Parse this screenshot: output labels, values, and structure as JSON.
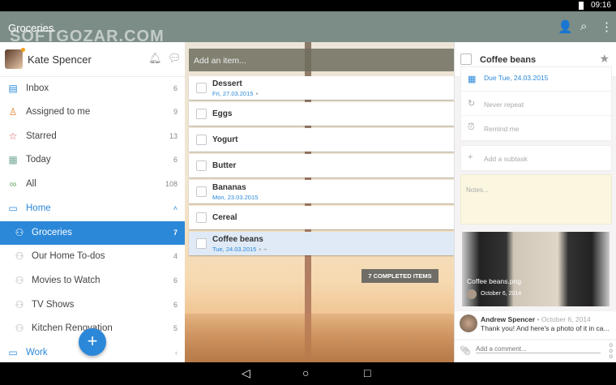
{
  "status": {
    "time": "09:16"
  },
  "appbar": {
    "title": "Groceries",
    "watermark": "SOFTGOZAR.COM"
  },
  "user": {
    "name": "Kate Spencer"
  },
  "sidebar": {
    "items": [
      {
        "label": "Inbox",
        "count": "6",
        "icon": "inbox-icon"
      },
      {
        "label": "Assigned to me",
        "count": "9",
        "icon": "person-icon"
      },
      {
        "label": "Starred",
        "count": "13",
        "icon": "star-icon"
      },
      {
        "label": "Today",
        "count": "6",
        "icon": "calendar-icon"
      },
      {
        "label": "All",
        "count": "108",
        "icon": "infinity-icon"
      },
      {
        "label": "Home",
        "count": "",
        "icon": "folder-icon"
      },
      {
        "label": "Groceries",
        "count": "7",
        "icon": "people-icon"
      },
      {
        "label": "Our Home To-dos",
        "count": "4",
        "icon": "people-icon"
      },
      {
        "label": "Movies to Watch",
        "count": "6",
        "icon": "people-icon"
      },
      {
        "label": "TV Shows",
        "count": "6",
        "icon": "people-icon"
      },
      {
        "label": "Kitchen Renovation",
        "count": "5",
        "icon": "people-icon"
      },
      {
        "label": "Work",
        "count": "",
        "icon": "folder-icon"
      }
    ]
  },
  "list": {
    "add_placeholder": "Add an item...",
    "tasks": [
      {
        "title": "Dessert",
        "date": "Fri, 27.03.2015"
      },
      {
        "title": "Eggs"
      },
      {
        "title": "Yogurt"
      },
      {
        "title": "Butter"
      },
      {
        "title": "Bananas",
        "date": "Mon, 23.03.2015"
      },
      {
        "title": "Cereal"
      },
      {
        "title": "Coffee beans",
        "date": "Tue, 24.03.2015"
      }
    ],
    "completed": "7 COMPLETED ITEMS"
  },
  "detail": {
    "title": "Coffee beans",
    "due": "Due Tue, 24.03.2015",
    "repeat": "Never repeat",
    "remind": "Remind me",
    "subtask": "Add a subtask",
    "notes": "Notes...",
    "file": {
      "name": "Coffee beans.png",
      "date": "October 6, 2014"
    },
    "comment": {
      "author": "Andrew Spencer",
      "date": "October 6, 2014",
      "text": "Thank you! And here's a photo of it in ca..."
    },
    "comment_placeholder": "Add a comment..."
  }
}
